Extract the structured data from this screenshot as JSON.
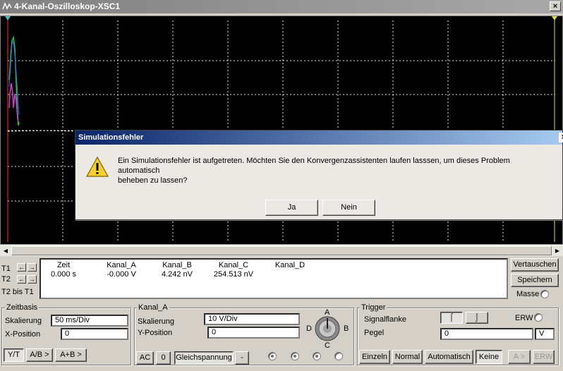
{
  "window": {
    "title": "4-Kanal-Oszilloskop-XSC1",
    "close_label": "×"
  },
  "colors": {
    "grid": "#ffffff",
    "cursor1": "#ff3030",
    "cursor2": "#e0e040",
    "channel_a": "#20d020",
    "channel_b": "#3060ff",
    "channel_c": "#d040d0",
    "trace_base": "#ffffff"
  },
  "cursors": {
    "t1_label": "T1",
    "t2_label": "T2",
    "t2_minus_t1_label": "T2 bis T1"
  },
  "readout": {
    "headers": [
      "Zeit",
      "Kanal_A",
      "Kanal_B",
      "Kanal_C",
      "Kanal_D"
    ],
    "values": [
      "0.000 s",
      "-0.000 V",
      "4.242 nV",
      "254.513 nV",
      ""
    ]
  },
  "side_buttons": {
    "swap": "Vertauschen",
    "save": "Speichern",
    "ground": "Masse"
  },
  "timebase": {
    "title": "Zeitbasis",
    "scale_label": "Skalierung",
    "scale_value": "50 ms/Div",
    "xpos_label": "X-Position",
    "xpos_value": "0",
    "modes": [
      "Y/T",
      "A/B >",
      "A+B >"
    ]
  },
  "channel": {
    "title": "Kanal_A",
    "scale_label": "Skalierung",
    "scale_value": "10  V/Div",
    "ypos_label": "Y-Position",
    "ypos_value": "0",
    "knob_labels": {
      "a": "A",
      "b": "B",
      "c": "C",
      "d": "D"
    },
    "coupling": [
      "AC",
      "0",
      "Gleichspannung",
      "-"
    ]
  },
  "trigger": {
    "title": "Trigger",
    "edge_label": "Signalflanke",
    "ext_label": "ERW",
    "level_label": "Pegel",
    "level_value": "0",
    "level_unit": "V",
    "modes": [
      "Einzeln",
      "Normal",
      "Automatisch",
      "Keine"
    ],
    "source_buttons": [
      "A >",
      "ERW"
    ]
  },
  "dialog": {
    "title": "Simulationsfehler",
    "close_label": "×",
    "message_line1": "Ein Simulationsfehler ist aufgetreten.  Möchten Sie den Konvergenzassistenten laufen lasssen, um dieses Problem automatisch",
    "message_line2": "beheben zu lassen?",
    "yes": "Ja",
    "no": "Nein"
  }
}
